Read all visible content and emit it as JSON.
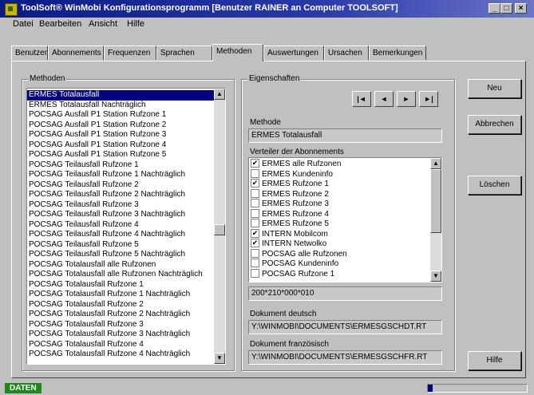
{
  "window": {
    "title": "ToolSoft® WinMobi Konfigurationsprogramm [Benutzer RAINER an Computer TOOLSOFT]",
    "icon": "app-icon",
    "minimize_label": "_",
    "maximize_label": "□",
    "close_label": "×"
  },
  "menu": [
    "Datei",
    "Bearbeiten",
    "Ansicht",
    "Hilfe"
  ],
  "tabs": [
    "Benutzer",
    "Abonnements",
    "Frequenzen",
    "Sprachen",
    "Methoden",
    "Auswertungen",
    "Ursachen",
    "Bemerkungen"
  ],
  "active_tab": "Methoden",
  "methoden": {
    "group_label": "Methoden",
    "items": [
      "ERMES Totalausfall",
      "ERMES Totalausfall Nachträglich",
      "POCSAG Ausfall P1 Station Rufzone 1",
      "POCSAG Ausfall P1 Station Rufzone 2",
      "POCSAG Ausfall P1 Station Rufzone 3",
      "POCSAG Ausfall P1 Station Rufzone 4",
      "POCSAG Ausfall P1 Station Rufzone 5",
      "POCSAG Teilausfall Rufzone 1",
      "POCSAG Teilausfall Rufzone 1 Nachträglich",
      "POCSAG Teilausfall Rufzone 2",
      "POCSAG Teilausfall Rufzone 2 Nachträglich",
      "POCSAG Teilausfall Rufzone 3",
      "POCSAG Teilausfall Rufzone 3 Nachträglich",
      "POCSAG Teilausfall Rufzone 4",
      "POCSAG Teilausfall Rufzone 4 Nachträglich",
      "POCSAG Teilausfall Rufzone 5",
      "POCSAG Teilausfall Rufzone 5 Nachträglich",
      "POCSAG Totalausfall alle Rufzonen",
      "POCSAG Totalausfall alle Rufzonen Nachträglich",
      "POCSAG Totalausfall Rufzone 1",
      "POCSAG Totalausfall Rufzone 1 Nachträglich",
      "POCSAG Totalausfall Rufzone 2",
      "POCSAG Totalausfall Rufzone 2 Nachträglich",
      "POCSAG Totalausfall Rufzone 3",
      "POCSAG Totalausfall Rufzone 3 Nachträglich",
      "POCSAG Totalausfall Rufzone 4",
      "POCSAG Totalausfall Rufzone 4 Nachträglich"
    ],
    "selected_index": 0
  },
  "eigenschaften": {
    "group_label": "Eigenschaften",
    "nav_buttons": [
      "|◄",
      "◄",
      "►",
      "►|"
    ],
    "methode_label": "Methode",
    "methode_value": "ERMES Totalausfall",
    "verteiler_label": "Verteiler der Abonnements",
    "verteiler_items": [
      {
        "label": "ERMES alle Rufzonen",
        "checked": true
      },
      {
        "label": "ERMES Kundeninfo",
        "checked": false
      },
      {
        "label": "ERMES Rufzone 1",
        "checked": true
      },
      {
        "label": "ERMES Rufzone 2",
        "checked": false
      },
      {
        "label": "ERMES Rufzone 3",
        "checked": false
      },
      {
        "label": "ERMES Rufzone 4",
        "checked": false
      },
      {
        "label": "ERMES Rufzone 5",
        "checked": false
      },
      {
        "label": "INTERN Mobilcom",
        "checked": true
      },
      {
        "label": "INTERN Netwolko",
        "checked": true
      },
      {
        "label": "POCSAG alle Rufzonen",
        "checked": false
      },
      {
        "label": "POCSAG Kundeninfo",
        "checked": false
      },
      {
        "label": "POCSAG Rufzone 1",
        "checked": false
      }
    ],
    "code_value": "200*210*000*010",
    "dokument_deutsch_label": "Dokument deutsch",
    "dokument_deutsch_value": "Y:\\WINMOBI\\DOCUMENTS\\ERMESGSCHDT.RT",
    "dokument_franzoesisch_label": "Dokument französisch",
    "dokument_franzoesisch_value": "Y:\\WINMOBI\\DOCUMENTS\\ERMESGSCHFR.RT"
  },
  "buttons": {
    "neu": "Neu",
    "abbrechen": "Abbrechen",
    "loeschen": "Löschen",
    "hilfe": "Hilfe"
  },
  "status": {
    "badge": "DATEN",
    "progress": 0.05
  }
}
